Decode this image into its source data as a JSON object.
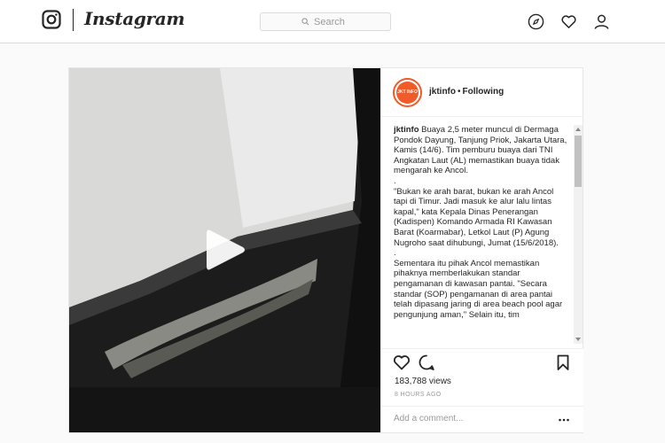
{
  "header": {
    "brand": "Instagram",
    "search_placeholder": "Search",
    "icons": [
      "instagram-logo-icon",
      "search-icon",
      "compass-icon",
      "heart-icon",
      "profile-icon"
    ]
  },
  "post": {
    "media": {
      "type": "video",
      "play_icon": "play-icon"
    },
    "author": {
      "avatar_text": "JKT INFO",
      "username": "jktinfo",
      "separator": "•",
      "follow_status": "Following"
    },
    "caption": {
      "username": "jktinfo",
      "paragraphs": [
        "Buaya 2,5 meter muncul di Dermaga Pondok Dayung, Tanjung Priok, Jakarta Utara, Kamis (14/6). Tim pemburu buaya dari TNI Angkatan Laut (AL) memastikan buaya tidak mengarah ke Ancol.",
        ".",
        "\"Bukan ke arah barat, bukan ke arah Ancol tapi di Timur. Jadi masuk ke alur lalu lintas kapal,\" kata Kepala Dinas Penerangan (Kadispen) Komando Armada RI Kawasan Barat (Koarmabar), Letkol Laut (P) Agung Nugroho saat dihubungi, Jumat (15/6/2018).",
        ".",
        "Sementara itu pihak Ancol memastikan pihaknya memberlakukan standar pengamanan di kawasan pantai. \"Secara standar (SOP) pengamanan di area pantai telah dipasang jaring di area beach pool agar pengunjung aman,\" Selain itu, tim"
      ]
    },
    "actions": {
      "icons": [
        "heart-icon",
        "comment-icon",
        "bookmark-icon"
      ]
    },
    "views": "183,788 views",
    "time_ago": "8 HOURS AGO",
    "comment_placeholder": "Add a comment...",
    "more_icon": "more-options-icon"
  },
  "colors": {
    "avatar_ring": "#f15a29",
    "border": "#dbdbdb",
    "muted_text": "#999999"
  }
}
